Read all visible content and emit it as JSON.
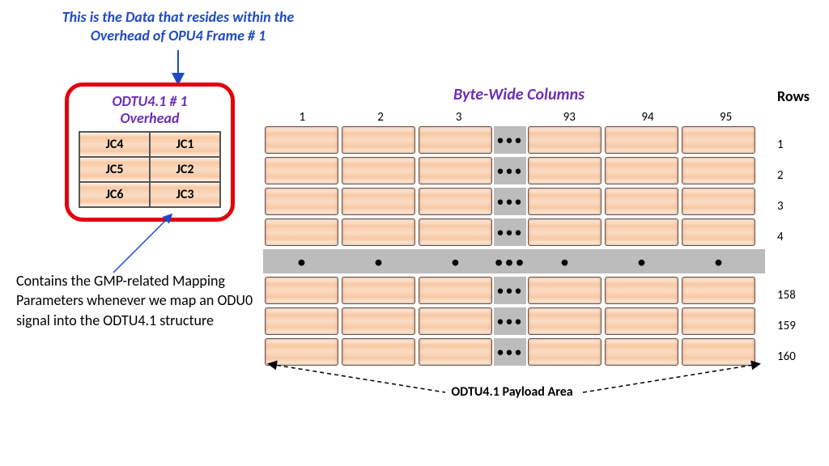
{
  "top_note": "This is the Data that resides within the Overhead of OPU4 Frame # 1",
  "overhead": {
    "title_l1": "ODTU4.1 # 1",
    "title_l2": "Overhead",
    "cells": [
      "JC4",
      "JC1",
      "JC5",
      "JC2",
      "JC6",
      "JC3"
    ]
  },
  "bottom_note": "Contains the GMP-related Mapping Parameters whenever we map an ODU0 signal into the ODTU4.1 structure",
  "payload": {
    "title": "Byte-Wide Columns",
    "rows_label": "Rows",
    "cols_left": [
      "1",
      "2",
      "3"
    ],
    "cols_right": [
      "93",
      "94",
      "95"
    ],
    "row_labels_top": [
      "1",
      "2",
      "3",
      "4"
    ],
    "row_labels_bot": [
      "158",
      "159",
      "160"
    ],
    "bottom_label": "ODTU4.1 Payload Area"
  },
  "chart_data": {
    "type": "table",
    "description": "ODTU4.1 frame structure diagram",
    "overhead_bytes": [
      [
        "JC4",
        "JC1"
      ],
      [
        "JC5",
        "JC2"
      ],
      [
        "JC6",
        "JC3"
      ]
    ],
    "payload_dimensions": {
      "columns": 95,
      "rows": 160
    },
    "visible_columns": [
      1,
      2,
      3,
      93,
      94,
      95
    ],
    "visible_rows": [
      1,
      2,
      3,
      4,
      158,
      159,
      160
    ]
  }
}
